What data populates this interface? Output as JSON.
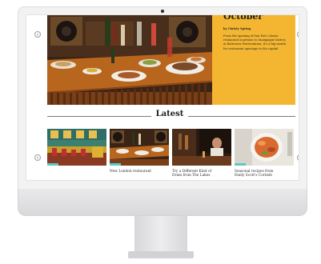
{
  "hero": {
    "title": "October",
    "byline": "by Christy Spring",
    "description": "From the opening of Sun Pat's classic restaurant in prisms to champagne bistros at Battersea Powerstation, it's a big month for restaurant openings in the capital",
    "prev_icon": "‹",
    "next_icon": "›"
  },
  "latest": {
    "heading": "Latest",
    "prev_icon": "‹",
    "next_icon": "›",
    "cards": [
      {
        "caption": ""
      },
      {
        "caption": "New London restaurant"
      },
      {
        "caption": "Try a Different Kind of\nDram from The Lakes"
      },
      {
        "caption": "Seasonal recipes from\nEmily Scott's Cornish"
      }
    ]
  },
  "colors": {
    "accent": "#f4b630",
    "tag": "#5ec7c9"
  }
}
